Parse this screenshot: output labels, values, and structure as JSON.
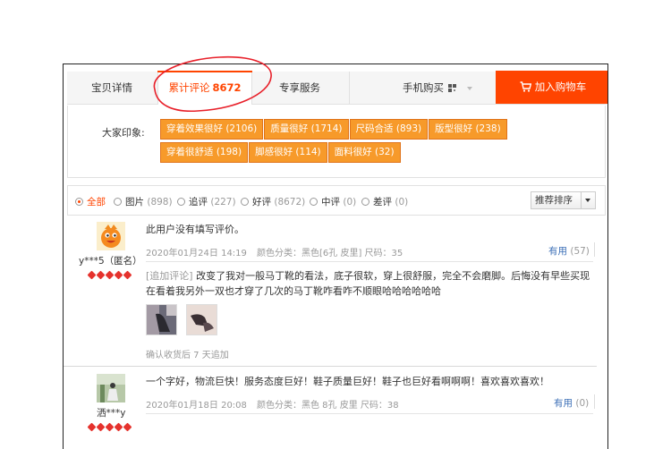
{
  "tabs": {
    "detail": "宝贝详情",
    "reviews_label": "累计评论",
    "reviews_count": "8672",
    "service": "专享服务",
    "mobile_buy": "手机购买",
    "add_to_cart": "加入购物车"
  },
  "impressions": {
    "label": "大家印象:",
    "tags": [
      "穿着效果很好 (2106)",
      "质量很好 (1714)",
      "尺码合适 (893)",
      "版型很好 (238)",
      "穿着很舒适 (198)",
      "脚感很好 (114)",
      "面料很好 (32)"
    ]
  },
  "filters": {
    "options": [
      {
        "label": "全部",
        "count": ""
      },
      {
        "label": "图片",
        "count": "(898)"
      },
      {
        "label": "追评",
        "count": "(227)"
      },
      {
        "label": "好评",
        "count": "(8672)"
      },
      {
        "label": "中评",
        "count": "(0)"
      },
      {
        "label": "差评",
        "count": "(0)"
      }
    ],
    "sort_label": "推荐排序"
  },
  "reviews": [
    {
      "user": "y***5（匿名）",
      "text": "此用户没有填写评价。",
      "date": "2020年01月24日 14:19",
      "spec": "颜色分类：黑色[6孔 皮里]  尺码：35",
      "useful_label": "有用",
      "useful_count": "(57)",
      "append_label": "[追加评论]",
      "append_text": "改变了我对一般马丁靴的看法，底子很软，穿上很舒服，完全不会磨脚。后悔没有早些买现在看着我另外一双也才穿了几次的马丁靴咋看咋不顺眼哈哈哈哈哈哈",
      "after": "确认收货后 7 天追加"
    },
    {
      "user": "洒***y",
      "text": "一个字好，物流巨快！服务态度巨好！鞋子质量巨好！鞋子也巨好看啊啊啊！喜欢喜欢喜欢！",
      "date": "2020年01月18日 20:08",
      "spec": "颜色分类：黑色 8孔 皮里  尺码：38",
      "useful_label": "有用",
      "useful_count": "(0)"
    }
  ],
  "colors": {
    "accent": "#ff4400",
    "tag_bg": "#f79a2a",
    "link": "#3c6fb7",
    "annotation_circle": "#e8202a"
  }
}
